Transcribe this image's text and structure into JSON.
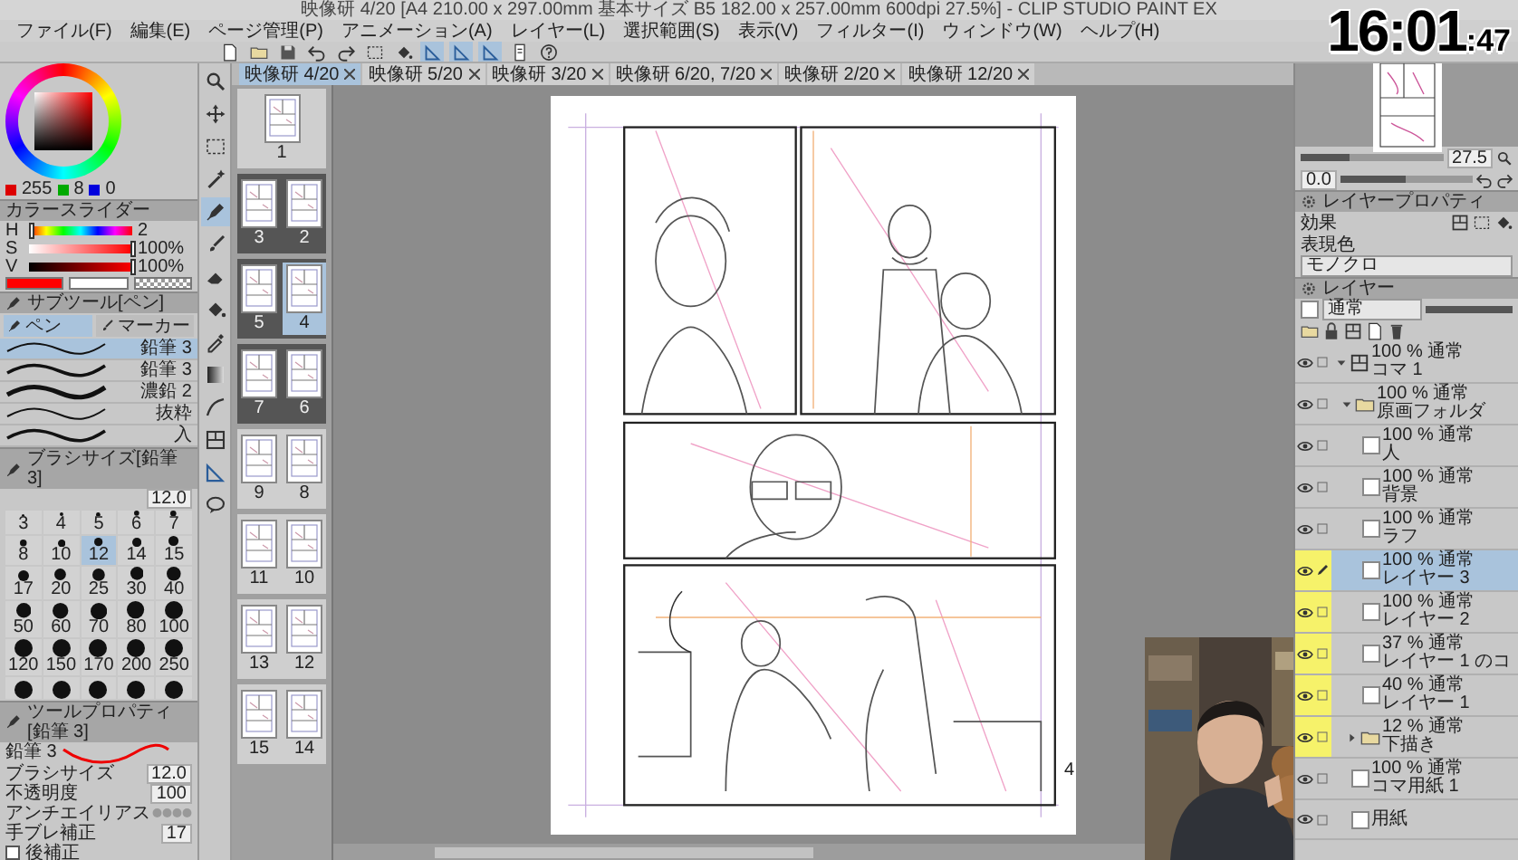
{
  "window": {
    "title": "映像研 4/20 [A4 210.00 x 297.00mm 基本サイズ B5 182.00 x 257.00mm 600dpi 27.5%] - CLIP STUDIO PAINT EX"
  },
  "menu": [
    "ファイル(F)",
    "編集(E)",
    "ページ管理(P)",
    "アニメーション(A)",
    "レイヤー(L)",
    "選択範囲(S)",
    "表示(V)",
    "フィルター(I)",
    "ウィンドウ(W)",
    "ヘルプ(H)"
  ],
  "toolbar": [
    {
      "kind": "new",
      "on": false
    },
    {
      "kind": "open",
      "on": false
    },
    {
      "kind": "save",
      "on": false
    },
    {
      "kind": "undo",
      "on": false
    },
    {
      "kind": "redo",
      "on": false
    },
    {
      "kind": "select",
      "on": false
    },
    {
      "kind": "fill",
      "on": false
    },
    {
      "kind": "ruler",
      "on": true
    },
    {
      "kind": "ruler",
      "on": true
    },
    {
      "kind": "ruler",
      "on": true
    },
    {
      "kind": "page",
      "on": false
    },
    {
      "kind": "help",
      "on": false
    }
  ],
  "clock": {
    "time": "16:01",
    "seconds": ":47"
  },
  "color": {
    "rgb": [
      "255",
      "8",
      "0"
    ],
    "swatches": [
      {
        "kind": "main",
        "color": "#ff0000"
      },
      {
        "kind": "sub",
        "color": "#ffffff"
      },
      {
        "kind": "clear"
      }
    ]
  },
  "color_slider": {
    "title": "カラースライダー",
    "rows": [
      {
        "label": "H",
        "value": "2",
        "level": 0.01
      },
      {
        "label": "S",
        "value": "100%",
        "level": 1
      },
      {
        "label": "V",
        "value": "100%",
        "level": 1
      }
    ]
  },
  "sub_tool": {
    "title": "サブツール[ペン]",
    "groups": [
      {
        "label": "ペン",
        "selected": true
      },
      {
        "label": "マーカー",
        "selected": false
      }
    ],
    "brushes": [
      {
        "name": "鉛筆 3",
        "selected": true
      },
      {
        "name": "鉛筆 3",
        "selected": false
      },
      {
        "name": "濃鉛 2",
        "selected": false
      },
      {
        "name": "抜粋",
        "selected": false
      },
      {
        "name": "入",
        "selected": false
      }
    ]
  },
  "brush_size": {
    "title": "ブラシサイズ[鉛筆 3]",
    "value": "12.0",
    "sizes": [
      {
        "label": "3",
        "selected": false
      },
      {
        "label": "4",
        "selected": false
      },
      {
        "label": "5",
        "selected": false
      },
      {
        "label": "6",
        "selected": false
      },
      {
        "label": "7",
        "selected": false
      },
      {
        "label": "8",
        "selected": false
      },
      {
        "label": "10",
        "selected": false
      },
      {
        "label": "12",
        "selected": true
      },
      {
        "label": "14",
        "selected": false
      },
      {
        "label": "15",
        "selected": false
      },
      {
        "label": "17",
        "selected": false
      },
      {
        "label": "20",
        "selected": false
      },
      {
        "label": "25",
        "selected": false
      },
      {
        "label": "30",
        "selected": false
      },
      {
        "label": "40",
        "selected": false
      },
      {
        "label": "50",
        "selected": false
      },
      {
        "label": "60",
        "selected": false
      },
      {
        "label": "70",
        "selected": false
      },
      {
        "label": "80",
        "selected": false
      },
      {
        "label": "100",
        "selected": false
      },
      {
        "label": "120",
        "selected": false
      },
      {
        "label": "150",
        "selected": false
      },
      {
        "label": "170",
        "selected": false
      },
      {
        "label": "200",
        "selected": false
      },
      {
        "label": "250",
        "selected": false
      },
      {
        "selected": false
      },
      {
        "selected": false
      },
      {
        "selected": false
      },
      {
        "selected": false
      },
      {
        "selected": false
      }
    ]
  },
  "tool_property": {
    "title": "ツールプロパティ[鉛筆 3]",
    "brush": "鉛筆 3",
    "rows": [
      {
        "kind": "value",
        "label": "ブラシサイズ",
        "value": "12.0"
      },
      {
        "kind": "value",
        "label": "不透明度",
        "value": "100"
      },
      {
        "kind": "antialias",
        "label": "アンチエイリアス"
      },
      {
        "kind": "value",
        "label": "手ブレ補正",
        "value": "17"
      },
      {
        "kind": "check",
        "label": "後補正",
        "checked": false
      }
    ]
  },
  "tools": [
    {
      "kind": "magnifier",
      "selected": false
    },
    {
      "kind": "move",
      "selected": false
    },
    {
      "kind": "select",
      "selected": false
    },
    {
      "kind": "wand",
      "selected": false
    },
    {
      "kind": "pen",
      "selected": true
    },
    {
      "kind": "brush",
      "selected": false
    },
    {
      "kind": "eraser",
      "selected": false
    },
    {
      "kind": "fill",
      "selected": false
    },
    {
      "kind": "eyedropper",
      "selected": false
    },
    {
      "kind": "gradient",
      "selected": false
    },
    {
      "kind": "shape",
      "selected": false
    },
    {
      "kind": "frame",
      "selected": false
    },
    {
      "kind": "ruler",
      "selected": false
    },
    {
      "kind": "balloon",
      "selected": false
    }
  ],
  "canvas_tabs": [
    {
      "label": "映像研 4/20",
      "selected": true
    },
    {
      "label": "映像研 5/20",
      "selected": false
    },
    {
      "label": "映像研 3/20",
      "selected": false
    },
    {
      "label": "映像研 6/20, 7/20",
      "selected": false
    },
    {
      "label": "映像研 2/20",
      "selected": false
    },
    {
      "label": "映像研 12/20",
      "selected": false
    }
  ],
  "pages": [
    {
      "open": false,
      "pages": [
        {
          "label": "1",
          "selected": false
        }
      ]
    },
    {
      "open": true,
      "pages": [
        {
          "label": "3",
          "selected": false
        },
        {
          "label": "2",
          "selected": false
        }
      ]
    },
    {
      "open": true,
      "pages": [
        {
          "label": "5",
          "selected": false
        },
        {
          "label": "4",
          "selected": true
        }
      ]
    },
    {
      "open": true,
      "pages": [
        {
          "label": "7",
          "selected": false
        },
        {
          "label": "6",
          "selected": false
        }
      ]
    },
    {
      "open": false,
      "pages": [
        {
          "label": "9",
          "selected": false
        },
        {
          "label": "8",
          "selected": false
        }
      ]
    },
    {
      "open": false,
      "pages": [
        {
          "label": "11",
          "selected": false
        },
        {
          "label": "10",
          "selected": false
        }
      ]
    },
    {
      "open": false,
      "pages": [
        {
          "label": "13",
          "selected": false
        },
        {
          "label": "12",
          "selected": false
        }
      ]
    },
    {
      "open": false,
      "pages": [
        {
          "label": "15",
          "selected": false
        },
        {
          "label": "14",
          "selected": false
        }
      ]
    }
  ],
  "page": {
    "page_number": "4"
  },
  "navigator": {
    "zoom": "27.5",
    "angle": "0.0",
    "sliders": [
      {
        "level": 0.35
      },
      {
        "level": 0.5
      }
    ]
  },
  "layer_property": {
    "title": "レイヤープロパティ",
    "effect_label": "効果",
    "color_label": "表現色",
    "color_mode": "モノクロ"
  },
  "layers": {
    "title": "レイヤー",
    "blend_mode": "通常",
    "opacity_slider": {
      "level": 1
    },
    "items": [
      {
        "kind": "frame",
        "opacity": "100 % 通常",
        "name": "コマ 1",
        "expanded": true,
        "marked": false,
        "selected": false,
        "children": [
          {
            "kind": "folder",
            "opacity": "100 % 通常",
            "name": "原画フォルダ",
            "expanded": true,
            "marked": false,
            "selected": false,
            "children": [
              {
                "kind": "layer",
                "opacity": "100 % 通常",
                "name": "人",
                "marked": false,
                "selected": false
              },
              {
                "kind": "layer",
                "opacity": "100 % 通常",
                "name": "背景",
                "marked": false,
                "selected": false
              },
              {
                "kind": "layer",
                "opacity": "100 % 通常",
                "name": "ラフ",
                "marked": false,
                "selected": false
              },
              {
                "kind": "layer",
                "opacity": "100 % 通常",
                "name": "レイヤー 3",
                "marked": true,
                "selected": true
              },
              {
                "kind": "layer",
                "opacity": "100 % 通常",
                "name": "レイヤー 2",
                "marked": true,
                "selected": false
              },
              {
                "kind": "layer",
                "opacity": "37 % 通常",
                "name": "レイヤー 1 のコ",
                "marked": true,
                "selected": false
              },
              {
                "kind": "layer",
                "opacity": "40 % 通常",
                "name": "レイヤー 1",
                "marked": true,
                "selected": false
              },
              {
                "kind": "folder",
                "opacity": "12 % 通常",
                "name": "下描き",
                "expanded": false,
                "marked": true,
                "selected": false
              }
            ]
          }
        ]
      },
      {
        "kind": "layer",
        "opacity": "100 % 通常",
        "name": "コマ用紙 1",
        "marked": false,
        "selected": false
      },
      {
        "kind": "paper",
        "name": "用紙",
        "marked": false,
        "selected": false
      }
    ]
  }
}
